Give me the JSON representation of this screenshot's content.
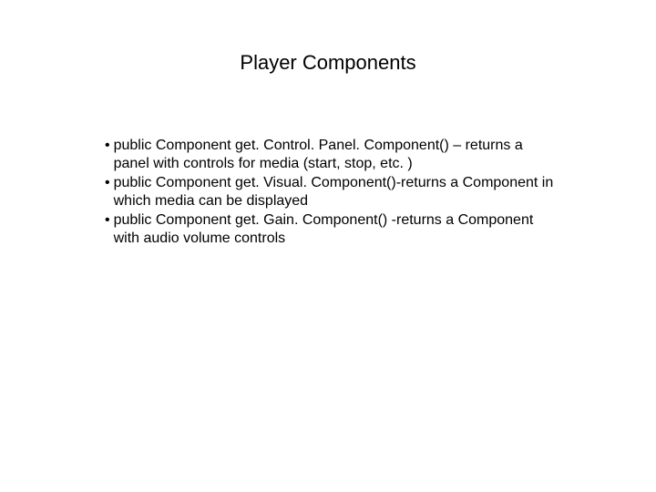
{
  "slide": {
    "title": "Player Components",
    "bullets": [
      {
        "marker": "•",
        "text": "public Component get. Control. Panel. Component() – returns a panel with controls for media (start, stop, etc. )"
      },
      {
        "marker": "•",
        "text": "public Component get. Visual. Component()-returns a Component in which media can be displayed"
      },
      {
        "marker": "•",
        "text": "public Component get. Gain. Component() -returns a Component with audio volume controls"
      }
    ]
  }
}
